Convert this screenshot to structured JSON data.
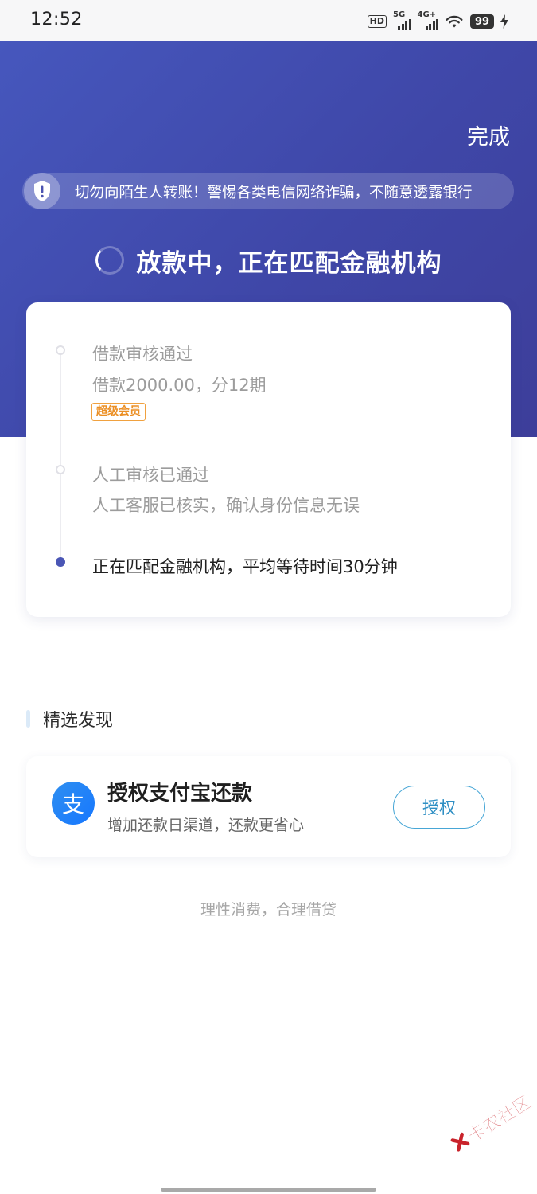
{
  "status_bar": {
    "time": "12:52",
    "hd_label": "HD",
    "network_1": "5G",
    "network_2": "4G+",
    "battery": "99"
  },
  "header": {
    "done_label": "完成",
    "notice_icon": "shield-icon",
    "notice_text": "切勿向陌生人转账！警惕各类电信网络诈骗，不随意透露银行",
    "status_title": "放款中，正在匹配金融机构",
    "gradient_colors": [
      "#4657bd",
      "#3d3e9a"
    ]
  },
  "progress": {
    "steps": [
      {
        "title": "借款审核通过",
        "desc": "借款2000.00，分12期",
        "badge": "超级会员"
      },
      {
        "title": "人工审核已通过",
        "desc": "人工客服已核实，确认身份信息无误"
      },
      {
        "title": "正在匹配金融机构，平均等待时间30分钟"
      }
    ],
    "active_color": "#4a56b5"
  },
  "discover": {
    "section_title": "精选发现",
    "card": {
      "icon": "alipay-icon",
      "icon_glyph": "支",
      "title": "授权支付宝还款",
      "subtitle": "增加还款日渠道，还款更省心",
      "button_label": "授权"
    }
  },
  "footer": {
    "slogan": "理性消费，合理借贷"
  },
  "watermark": {
    "text": "卡农社区"
  }
}
